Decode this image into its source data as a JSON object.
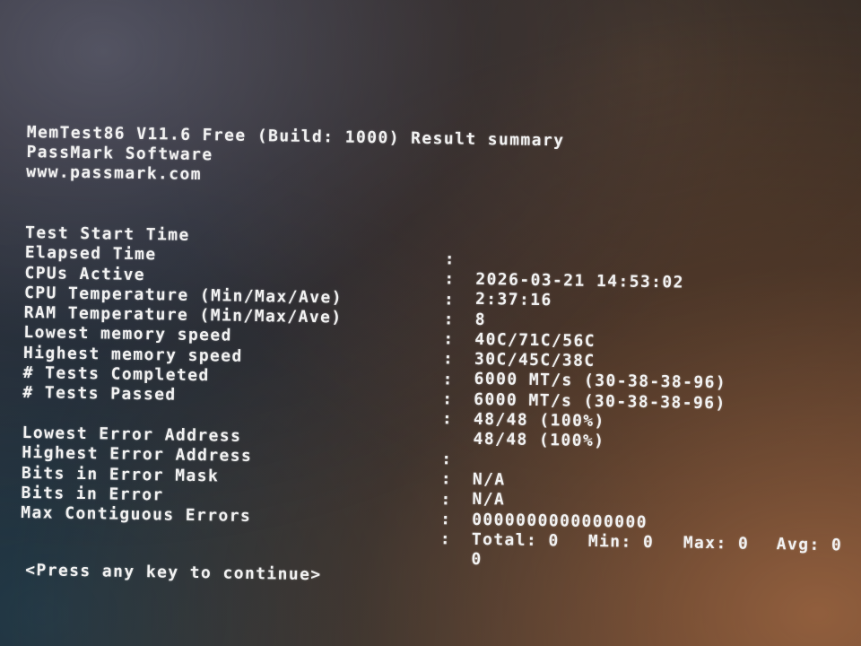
{
  "header": {
    "title": "MemTest86 V11.6 Free (Build: 1000) Result summary",
    "company": "PassMark Software",
    "url": "www.passmark.com"
  },
  "summary": [
    {
      "label": "Test Start Time",
      "value": "2026-03-21 14:53:02"
    },
    {
      "label": "Elapsed Time",
      "value": "2:37:16"
    },
    {
      "label": "CPUs Active",
      "value": "8"
    },
    {
      "label": "CPU Temperature (Min/Max/Ave)",
      "value": "40C/71C/56C"
    },
    {
      "label": "RAM Temperature (Min/Max/Ave)",
      "value": "30C/45C/38C"
    },
    {
      "label": "Lowest memory speed",
      "value": "6000 MT/s (30-38-38-96)"
    },
    {
      "label": "Highest memory speed",
      "value": "6000 MT/s (30-38-38-96)"
    },
    {
      "label": "# Tests Completed",
      "value": "48/48 (100%)"
    },
    {
      "label": "# Tests Passed",
      "value": "48/48 (100%)"
    }
  ],
  "errors": [
    {
      "label": "Lowest Error Address",
      "value": "N/A"
    },
    {
      "label": "Highest Error Address",
      "value": "N/A"
    },
    {
      "label": "Bits in Error Mask",
      "value": "0000000000000000"
    }
  ],
  "bits_in_error": {
    "label": "Bits in Error",
    "total": "Total: 0",
    "min": "Min: 0",
    "max": "Max: 0",
    "avg": "Avg: 0"
  },
  "max_contiguous": {
    "label": "Max Contiguous Errors",
    "value": "0"
  },
  "separator": ":",
  "footer": "<Press any key to continue>"
}
